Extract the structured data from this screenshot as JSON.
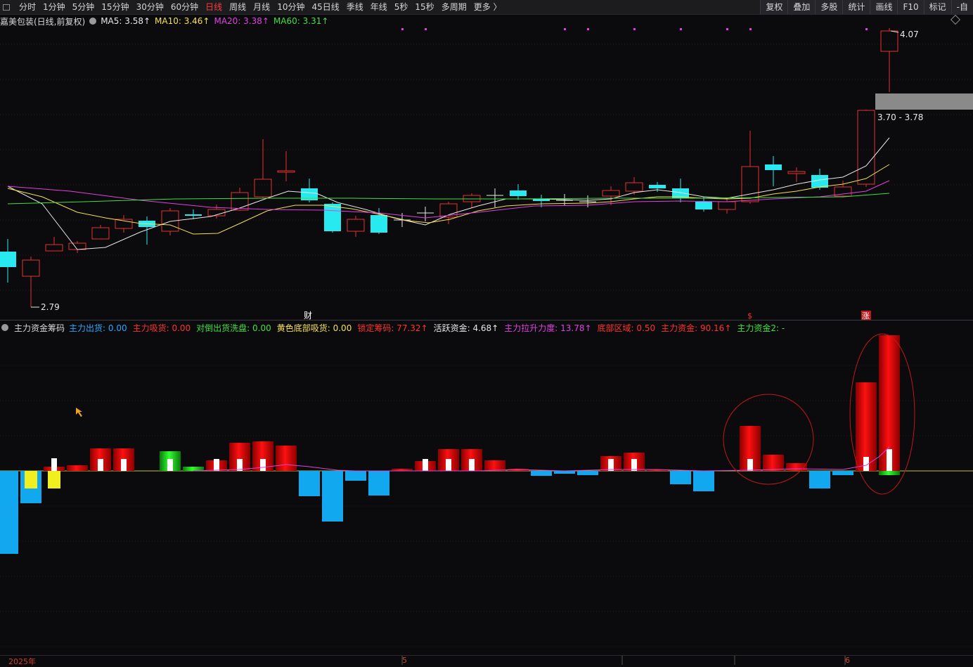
{
  "toolbar": {
    "periods": [
      "分时",
      "1分钟",
      "5分钟",
      "15分钟",
      "30分钟",
      "60分钟",
      "日线",
      "周线",
      "月线",
      "10分钟",
      "45日线",
      "季线",
      "年线",
      "5秒",
      "15秒",
      "多周期",
      "更多 〉"
    ],
    "active_period": "日线",
    "right_buttons": [
      "复权",
      "叠加",
      "多股",
      "统计",
      "画线",
      "F10",
      "标记",
      "-自"
    ]
  },
  "main_chart": {
    "stock_name": "嘉美包装(日线,前复权)",
    "ma": [
      {
        "label": "MA5: 3.58↑",
        "color": "#e8e8e8"
      },
      {
        "label": "MA10: 3.46↑",
        "color": "#f5e050"
      },
      {
        "label": "MA20: 3.38↑",
        "color": "#e040e0"
      },
      {
        "label": "MA60: 3.31↑",
        "color": "#40e040"
      }
    ],
    "high_label": "4.07",
    "low_label": "2.79",
    "range_label": "3.70 - 3.78",
    "markers": [
      {
        "text": "财",
        "color": "#ffffff"
      },
      {
        "text": "$",
        "color": "#ff3030"
      },
      {
        "text": "涨",
        "color": "#ffffff",
        "bg": "#c01818"
      }
    ]
  },
  "indicator": {
    "name": "主力资金筹码",
    "items": [
      {
        "label": "主力出货: 0.00",
        "color": "#2aa8ff"
      },
      {
        "label": "主力吸货: 0.00",
        "color": "#ff3030"
      },
      {
        "label": "对倒出货洗盘: 0.00",
        "color": "#40e040"
      },
      {
        "label": "黄色底部吸货: 0.00",
        "color": "#f5e050"
      },
      {
        "label": "锁定筹码: 77.32↑",
        "color": "#ff3030"
      },
      {
        "label": "活跃资金: 4.68↑",
        "color": "#e8e8e8"
      },
      {
        "label": "主力拉升力度: 13.78↑",
        "color": "#e040e0"
      },
      {
        "label": "底部区域: 0.50",
        "color": "#ff3030"
      },
      {
        "label": "主力资金: 90.16↑",
        "color": "#ff3030"
      },
      {
        "label": "主力资金2: -",
        "color": "#40e040"
      }
    ]
  },
  "xaxis": {
    "labels": [
      "2025年",
      "5",
      "6"
    ]
  },
  "colors": {
    "up": "#e53030",
    "down": "#28e8f0",
    "ma5": "#e8e8e8",
    "ma10": "#f5e050",
    "ma20": "#e040e0",
    "ma60": "#40e040",
    "bar_up": "#e00000",
    "bar_down": "#12a8f0",
    "bar_yellow": "#f0f020",
    "bar_green": "#10c010"
  }
}
